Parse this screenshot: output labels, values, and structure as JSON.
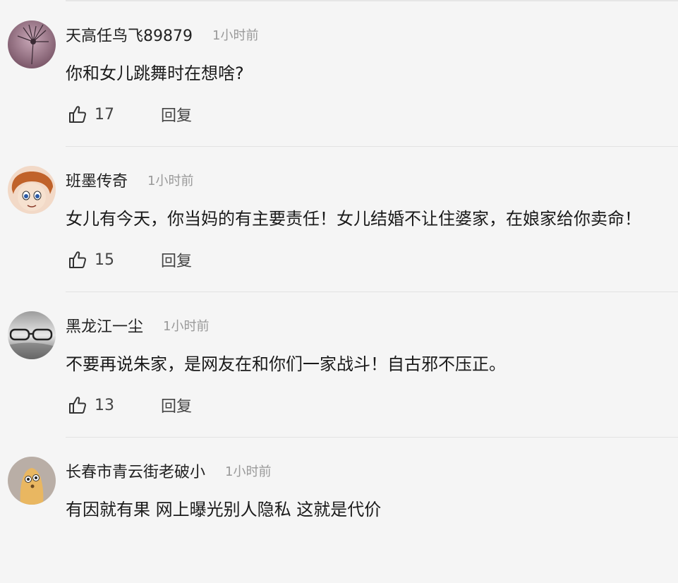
{
  "comments": [
    {
      "username": "天高任鸟飞89879",
      "time": "1小时前",
      "content": "你和女儿跳舞时在想啥?",
      "likes": "17",
      "reply_label": "回复",
      "avatar_icon": "dandelion-avatar"
    },
    {
      "username": "班墨传奇",
      "time": "1小时前",
      "content": "女儿有今天，你当妈的有主要责任！女儿结婚不让住婆家，在娘家给你卖命！",
      "likes": "15",
      "reply_label": "回复",
      "avatar_icon": "cartoon-boy-avatar"
    },
    {
      "username": "黑龙江一尘",
      "time": "1小时前",
      "content": "不要再说朱家，是网友在和你们一家战斗！自古邪不压正。",
      "likes": "13",
      "reply_label": "回复",
      "avatar_icon": "glasses-avatar"
    },
    {
      "username": "长春市青云街老破小",
      "time": "1小时前",
      "content": "有因就有果 网上曝光别人隐私 这就是代价",
      "likes": "",
      "reply_label": "",
      "avatar_icon": "cartoon-character-avatar"
    }
  ],
  "colors": {
    "background": "#f5f5f5",
    "divider": "#e3e3e3",
    "username": "#222222",
    "time": "#999999",
    "text": "#1a1a1a"
  }
}
